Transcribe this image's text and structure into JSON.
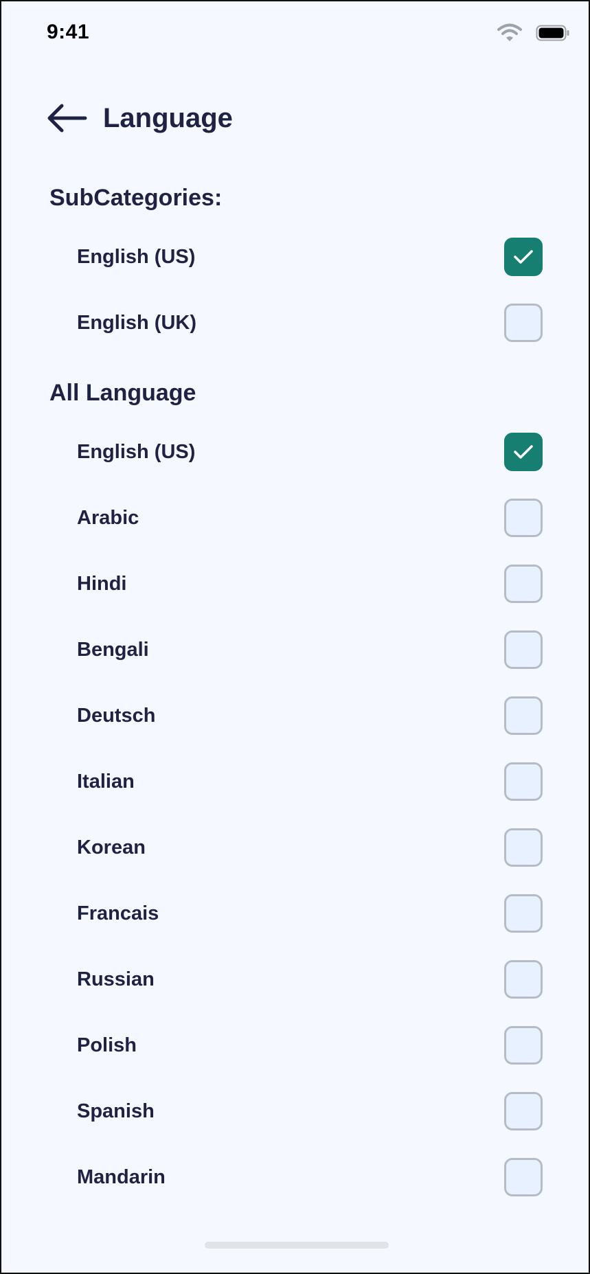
{
  "status_bar": {
    "time": "9:41",
    "wifi_icon": "wifi-icon",
    "battery_icon": "battery-icon"
  },
  "header": {
    "back_icon": "arrow-left-icon",
    "title": "Language"
  },
  "subcategories": {
    "title": "SubCategories:",
    "items": [
      {
        "label": "English (US)",
        "checked": true
      },
      {
        "label": "English (UK)",
        "checked": false
      }
    ]
  },
  "all_languages": {
    "title": "All Language",
    "items": [
      {
        "label": "English (US)",
        "checked": true
      },
      {
        "label": "Arabic",
        "checked": false
      },
      {
        "label": "Hindi",
        "checked": false
      },
      {
        "label": "Bengali",
        "checked": false
      },
      {
        "label": "Deutsch",
        "checked": false
      },
      {
        "label": "Italian",
        "checked": false
      },
      {
        "label": "Korean",
        "checked": false
      },
      {
        "label": "Francais",
        "checked": false
      },
      {
        "label": "Russian",
        "checked": false
      },
      {
        "label": "Polish",
        "checked": false
      },
      {
        "label": "Spanish",
        "checked": false
      },
      {
        "label": "Mandarin",
        "checked": false
      }
    ]
  },
  "colors": {
    "accent": "#167F71",
    "text": "#202244",
    "background": "#F5F9FF",
    "checkbox_border": "#B4BDC4",
    "checkbox_fill": "#E8F1FF"
  }
}
